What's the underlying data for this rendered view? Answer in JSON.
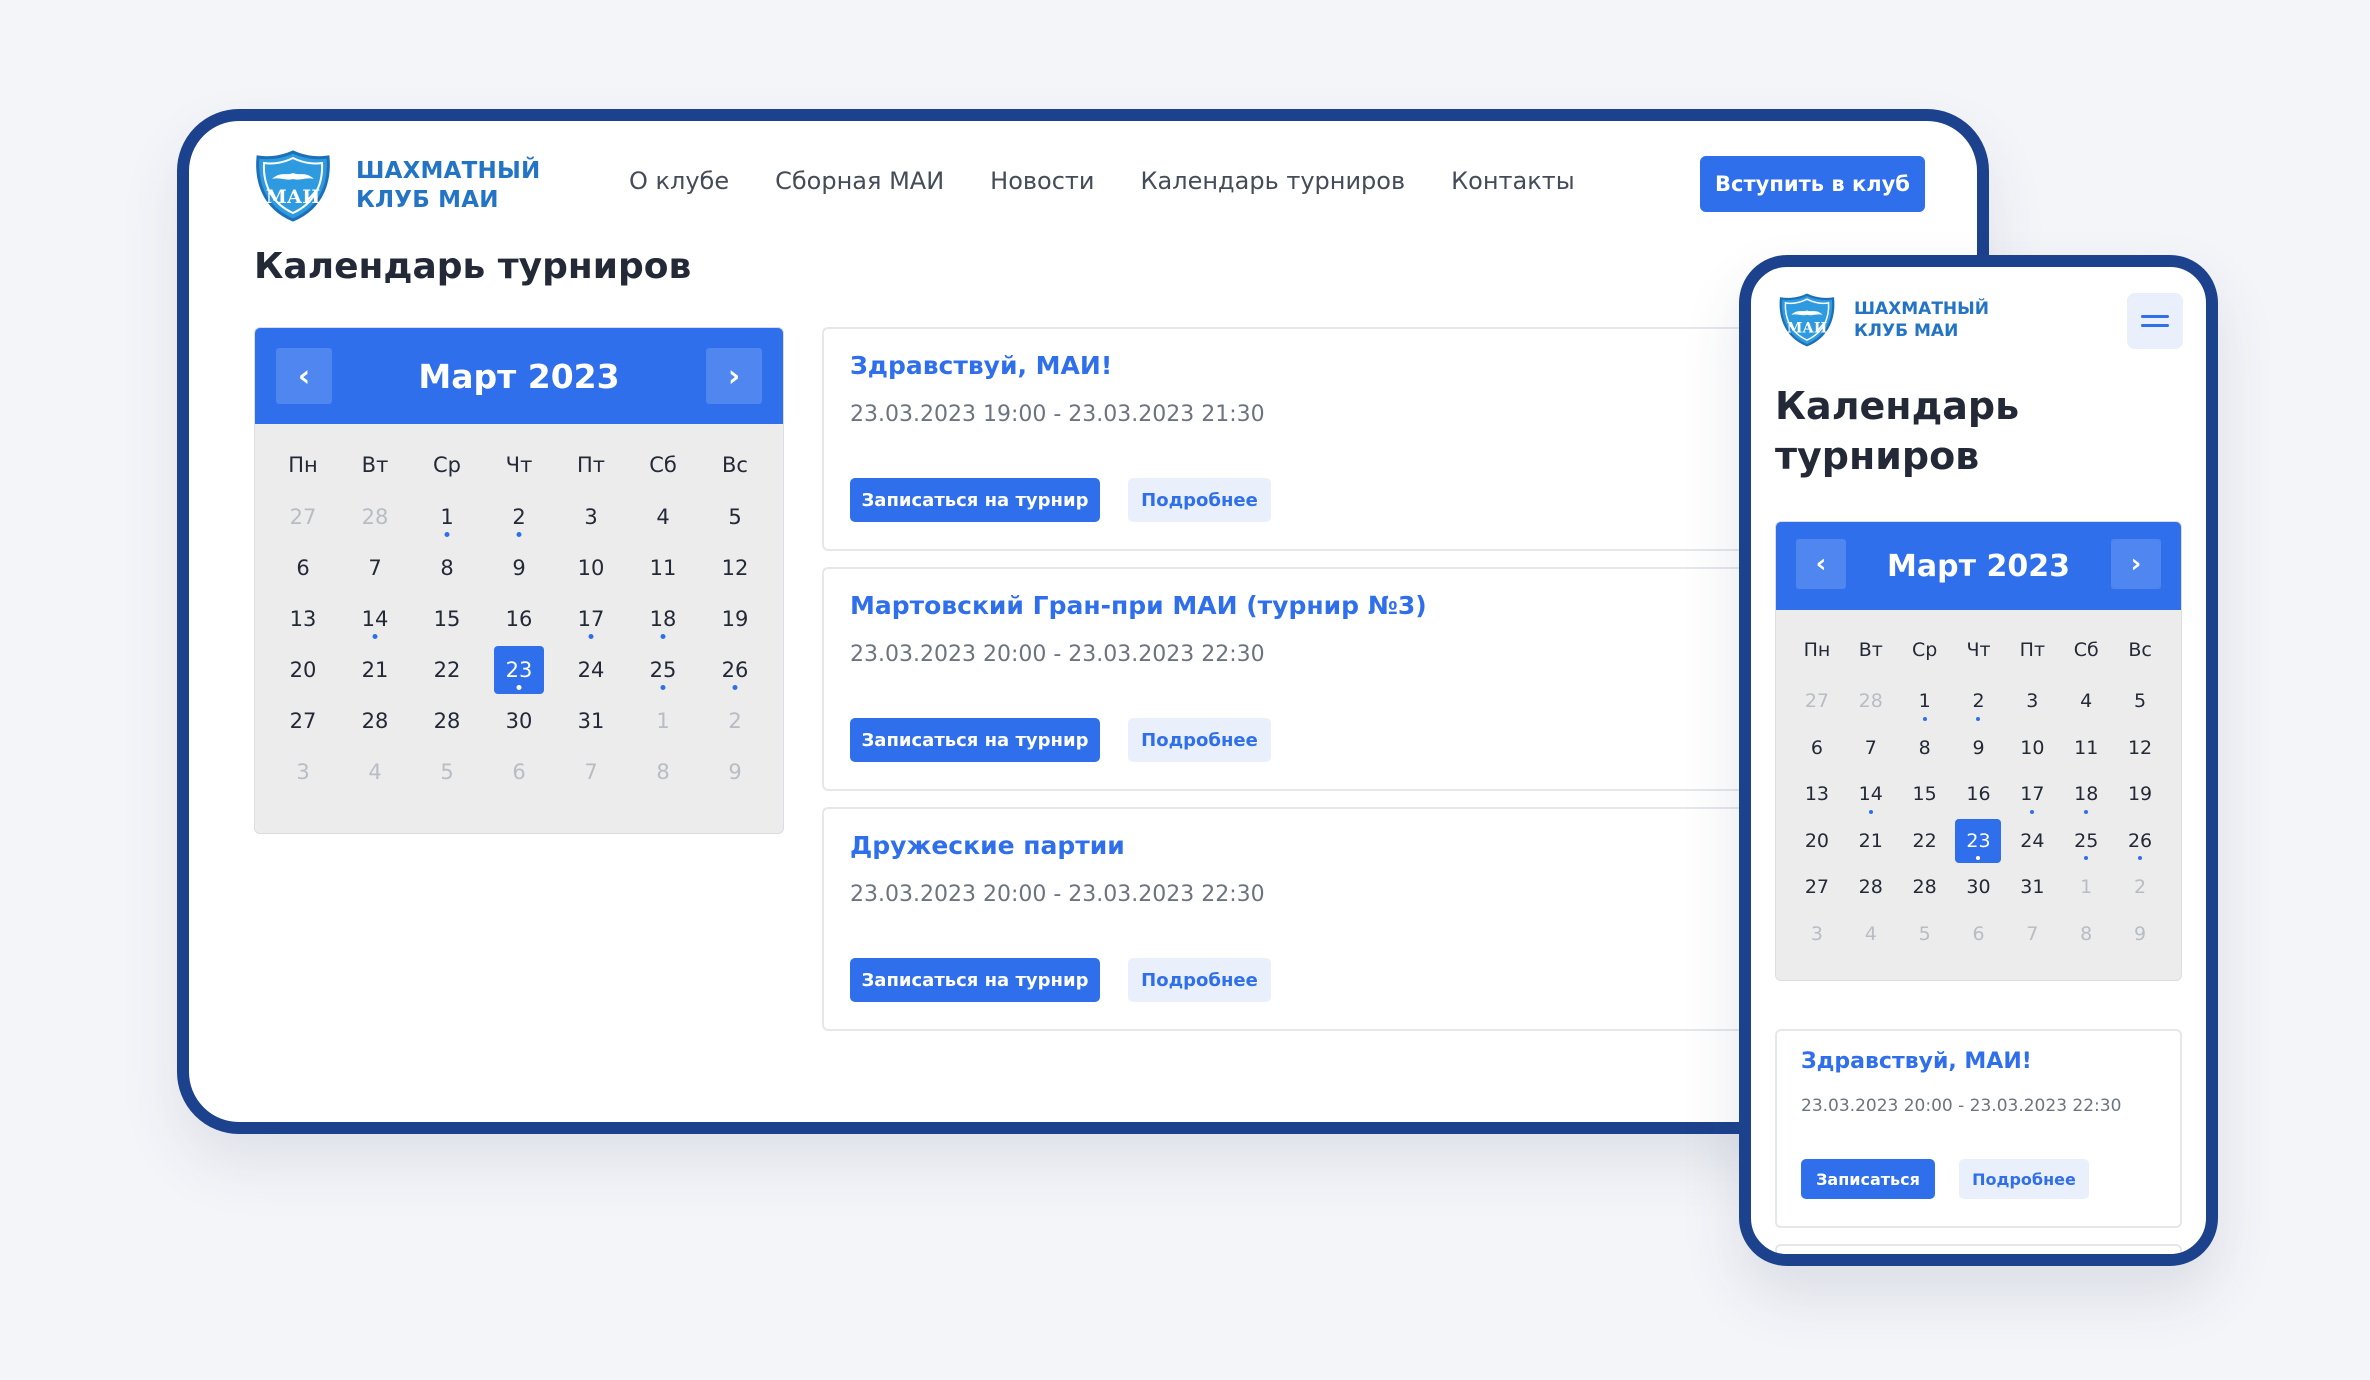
{
  "brand": {
    "name": "ШАХМАТНЫЙ КЛУБ МАИ",
    "logo_lettering": "МАИ",
    "accent": "#2f6fec",
    "frame": "#1d428d"
  },
  "nav": {
    "items": [
      "О клубе",
      "Сборная МАИ",
      "Новости",
      "Календарь турниров",
      "Контакты"
    ],
    "cta": "Вступить в клуб"
  },
  "page_title": "Календарь турниров",
  "calendar": {
    "month": "Март 2023",
    "prev_icon": "chevron-left-icon",
    "next_icon": "chevron-right-icon",
    "weekdays": [
      "Пн",
      "Вт",
      "Ср",
      "Чт",
      "Пт",
      "Сб",
      "Вс"
    ],
    "weeks": [
      [
        "27",
        "28",
        "1",
        "2",
        "3",
        "4",
        "5"
      ],
      [
        "6",
        "7",
        "8",
        "9",
        "10",
        "11",
        "12"
      ],
      [
        "13",
        "14",
        "15",
        "16",
        "17",
        "18",
        "19"
      ],
      [
        "20",
        "21",
        "22",
        "23",
        "24",
        "25",
        "26"
      ],
      [
        "27",
        "28",
        "28",
        "30",
        "31",
        "1",
        "2"
      ],
      [
        "3",
        "4",
        "5",
        "6",
        "7",
        "8",
        "9"
      ]
    ],
    "muted": [
      [
        0,
        0
      ],
      [
        0,
        1
      ],
      [
        4,
        5
      ],
      [
        4,
        6
      ],
      [
        5,
        0
      ],
      [
        5,
        1
      ],
      [
        5,
        2
      ],
      [
        5,
        3
      ],
      [
        5,
        4
      ],
      [
        5,
        5
      ],
      [
        5,
        6
      ]
    ],
    "event_days": [
      [
        0,
        2
      ],
      [
        0,
        3
      ],
      [
        2,
        1
      ],
      [
        2,
        4
      ],
      [
        2,
        5
      ],
      [
        3,
        3
      ],
      [
        3,
        5
      ],
      [
        3,
        6
      ]
    ],
    "selected": [
      3,
      3
    ]
  },
  "events": [
    {
      "title": "Здравствуй, МАИ!",
      "date": "23.03.2023 19:00 - 23.03.2023 21:30",
      "register": "Записаться на турнир",
      "details": "Подробнее"
    },
    {
      "title": "Мартовский Гран-при МАИ (турнир №3)",
      "date": "23.03.2023 20:00 - 23.03.2023 22:30",
      "register": "Записаться на турнир",
      "details": "Подробнее"
    },
    {
      "title": "Дружеские партии",
      "date": "23.03.2023 20:00 - 23.03.2023 22:30",
      "register": "Записаться на турнир",
      "details": "Подробнее"
    }
  ],
  "mobile": {
    "title": "Календарь турниров",
    "menu_icon": "hamburger-menu-icon",
    "event": {
      "title": "Здравствуй, МАИ!",
      "date": "23.03.2023 20:00 - 23.03.2023 22:30",
      "register": "Записаться",
      "details": "Подробнее"
    }
  }
}
